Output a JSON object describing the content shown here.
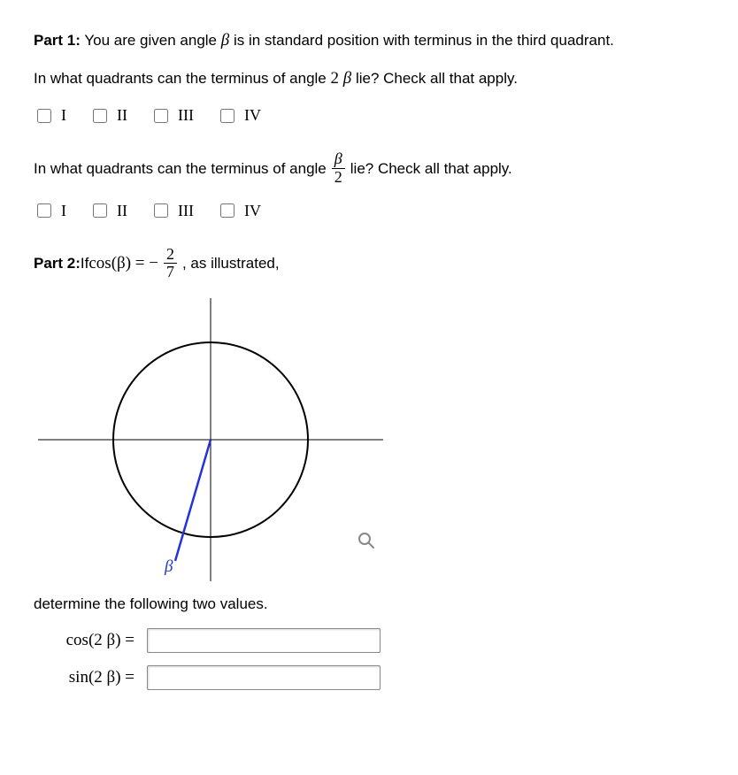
{
  "part1": {
    "label": "Part 1:",
    "intro": " You are given angle  ",
    "beta": "β",
    "intro2": "  is in standard position with terminus in the third quadrant.",
    "q1": "In what quadrants can the terminus of angle  ",
    "q1_angle_pre": "2 ",
    "q1_angle_beta": "β",
    "q1_tail": "  lie?  Check all that apply.",
    "options": [
      "I",
      "II",
      "III",
      "IV"
    ],
    "q2_a": "In what quadrants can the terminus of angle  ",
    "q2_frac_num": "β",
    "q2_frac_den": "2",
    "q2_b": "  lie?  Check all that apply."
  },
  "part2": {
    "label": "Part 2:",
    "text_a": " If  ",
    "cos_lhs": "cos(β)  =  − ",
    "frac_num": "2",
    "frac_den": "7",
    "text_b": " , as illustrated,",
    "beta_label": "β",
    "determine": "determine the following two values.",
    "ans1_label": "cos(2 β)  =",
    "ans2_label": "sin(2 β)  =",
    "ans1_value": "",
    "ans2_value": ""
  },
  "chart_data": {
    "type": "unit-circle-diagram",
    "description": "Cartesian axes with a circle centered at origin; a blue radial line in the third quadrant labeled β indicates cos(β) = -2/7.",
    "cos_beta": -0.2857,
    "quadrant": 3
  }
}
